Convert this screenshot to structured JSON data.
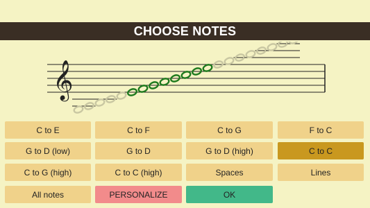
{
  "header": {
    "title": "CHOOSE NOTES"
  },
  "colors": {
    "background": "#f5f3c4",
    "header_bg": "#3a2e24",
    "button": "#f0d28a",
    "button_selected": "#c9981f",
    "personalize": "#f28b8b",
    "ok": "#42b889",
    "note_active": "#1e7a1e",
    "note_inactive": "#c9c7a2"
  },
  "staff": {
    "clef_icon": "treble-clef-icon",
    "notes": [
      {
        "pitch": "C",
        "active": false
      },
      {
        "pitch": "D",
        "active": false
      },
      {
        "pitch": "E",
        "active": false
      },
      {
        "pitch": "F",
        "active": false
      },
      {
        "pitch": "G",
        "active": false
      },
      {
        "pitch": "C",
        "active": true
      },
      {
        "pitch": "D",
        "active": true
      },
      {
        "pitch": "E",
        "active": true
      },
      {
        "pitch": "F",
        "active": true
      },
      {
        "pitch": "G",
        "active": true
      },
      {
        "pitch": "A",
        "active": true
      },
      {
        "pitch": "B",
        "active": true
      },
      {
        "pitch": "C",
        "active": true
      },
      {
        "pitch": "D",
        "active": false
      },
      {
        "pitch": "E",
        "active": false
      },
      {
        "pitch": "F",
        "active": false
      },
      {
        "pitch": "G",
        "active": false
      },
      {
        "pitch": "A",
        "active": false
      },
      {
        "pitch": "B",
        "active": false
      },
      {
        "pitch": "C",
        "active": false
      },
      {
        "pitch": "D",
        "active": false
      }
    ]
  },
  "options": [
    {
      "label": "C to E",
      "selected": false
    },
    {
      "label": "C to F",
      "selected": false
    },
    {
      "label": "C to G",
      "selected": false
    },
    {
      "label": "F to C",
      "selected": false
    },
    {
      "label": "G to D (low)",
      "selected": false
    },
    {
      "label": "G to D",
      "selected": false
    },
    {
      "label": "G to D (high)",
      "selected": false
    },
    {
      "label": "C to C",
      "selected": true
    },
    {
      "label": "C to G (high)",
      "selected": false
    },
    {
      "label": "C to C (high)",
      "selected": false
    },
    {
      "label": "Spaces",
      "selected": false
    },
    {
      "label": "Lines",
      "selected": false
    },
    {
      "label": "All notes",
      "selected": false
    }
  ],
  "actions": {
    "personalize_label": "PERSONALIZE",
    "ok_label": "OK"
  }
}
